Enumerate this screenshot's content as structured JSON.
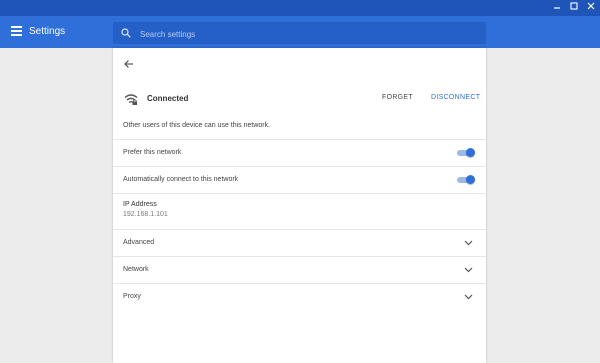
{
  "window": {
    "controls": [
      "minimize-icon",
      "maximize-icon",
      "close-icon"
    ]
  },
  "header": {
    "title": "Settings",
    "menu_icon": "menu-icon"
  },
  "search": {
    "placeholder": "Search settings",
    "icon": "search-icon"
  },
  "network_detail": {
    "back_icon": "back-arrow-icon",
    "status": "Connected",
    "wifi_icon": "wifi-locked-icon",
    "forget_label": "FORGET",
    "disconnect_label": "DISCONNECT",
    "shared_note": "Other users of this device can use this network.",
    "prefer_label": "Prefer this network",
    "prefer_on": true,
    "auto_connect_label": "Automatically connect to this network",
    "auto_connect_on": true,
    "ip_label": "IP Address",
    "ip_value": "192.168.1.101",
    "sections": [
      {
        "label": "Advanced"
      },
      {
        "label": "Network"
      },
      {
        "label": "Proxy"
      }
    ]
  },
  "colors": {
    "titlebar": "#1f55b9",
    "header": "#2f6fd9",
    "accent": "#2f6fd9",
    "background": "#ececec"
  }
}
